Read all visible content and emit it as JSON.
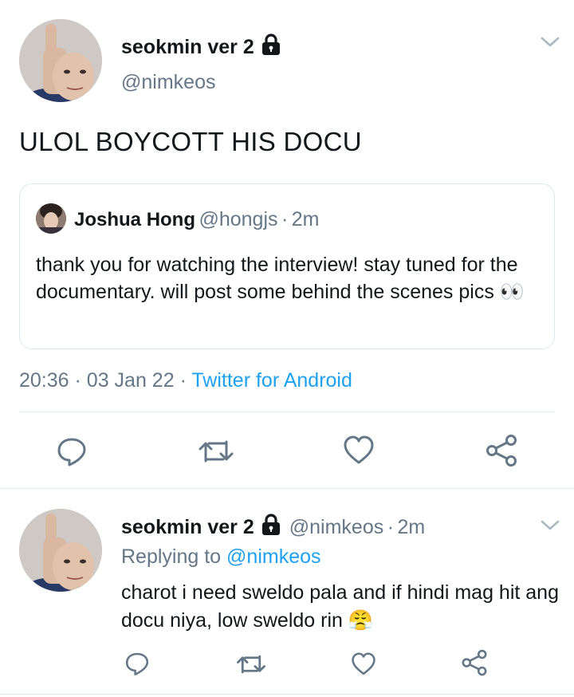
{
  "tweet": {
    "author_name": "seokmin ver 2",
    "author_handle": "@nimkeos",
    "text": "ULOL BOYCOTT HIS DOCU",
    "quoted": {
      "name": "Joshua Hong",
      "handle": "@hongjs",
      "sep": "·",
      "time": "2m",
      "text": "thank you for watching the interview! stay tuned for the documentary. will post some behind the scenes pics 👀"
    },
    "time": "20:36",
    "sep1": "·",
    "date": "03 Jan 22",
    "sep2": "·",
    "source": "Twitter for Android"
  },
  "reply": {
    "author_name": "seokmin ver 2",
    "author_handle": "@nimkeos",
    "sep": "·",
    "time": "2m",
    "replying_prefix": "Replying to",
    "replying_to": "@nimkeos",
    "text": "charot i need sweldo pala and if hindi mag hit ang docu niya, low sweldo rin 😤"
  },
  "icons": {
    "lock": "lock-icon",
    "caret": "chevron-down-icon",
    "reply": "reply-icon",
    "retweet": "retweet-icon",
    "like": "heart-icon",
    "share": "share-icon"
  },
  "colors": {
    "accent": "#1da1f2",
    "icon": "#657786",
    "divider": "#e1e8ed"
  }
}
